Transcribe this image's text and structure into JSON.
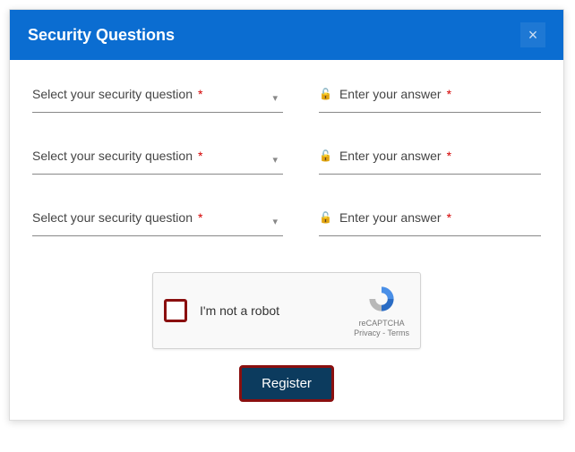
{
  "header": {
    "title": "Security Questions",
    "close_symbol": "×"
  },
  "rows": [
    {
      "question_label": "Select your security question",
      "answer_label": "Enter your answer"
    },
    {
      "question_label": "Select your security question",
      "answer_label": "Enter your answer"
    },
    {
      "question_label": "Select your security question",
      "answer_label": "Enter your answer"
    }
  ],
  "required_mark": "*",
  "dropdown_caret": "▾",
  "lock_glyph": "🔓",
  "captcha": {
    "label": "I'm not a robot",
    "brand": "reCAPTCHA",
    "links": "Privacy - Terms"
  },
  "actions": {
    "register": "Register"
  }
}
